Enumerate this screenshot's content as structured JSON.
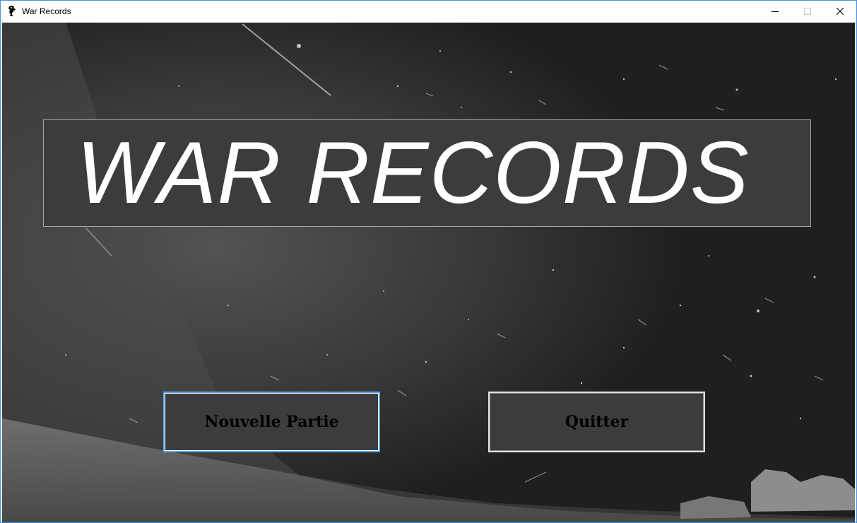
{
  "window": {
    "title": "War Records",
    "icon": "app-icon",
    "controls": [
      "minimize-icon",
      "maximize-icon",
      "close-icon"
    ]
  },
  "main": {
    "game_title": "WAR RECORDS",
    "buttons": {
      "new_game": "Nouvelle Partie",
      "quit": "Quitter"
    }
  },
  "colors": {
    "panel": "#3c3c3c",
    "focus_border": "#5aa6ea",
    "title_text": "#ffffff"
  }
}
